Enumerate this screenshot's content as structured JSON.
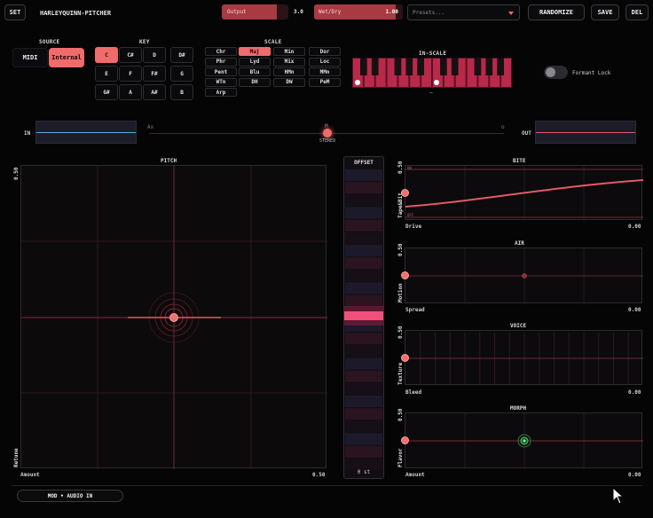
{
  "header": {
    "set_label": "SET",
    "plugin_name": "HARLEYQUINN-PITCHER",
    "output_label": "Output",
    "output_value": "3.0",
    "wet_label": "Wet/Dry",
    "wet_value": "1.00",
    "wet_fraction": 0.92,
    "output_fraction": 0.82,
    "presets_placeholder": "Presets...",
    "randomize_label": "RANDOMIZE",
    "save_label": "SAVE",
    "del_label": "DEL"
  },
  "source": {
    "title": "SOURCE",
    "options": [
      "MIDI",
      "Internal"
    ],
    "selected": "Internal"
  },
  "key": {
    "title": "KEY",
    "keys": [
      "C",
      "C#",
      "D",
      "D#",
      "E",
      "F",
      "F#",
      "G",
      "G#",
      "A",
      "A#",
      "B"
    ],
    "selected": "C"
  },
  "scale": {
    "title": "SCALE",
    "items": [
      "Chr",
      "Maj",
      "Min",
      "Dor",
      "Phr",
      "Lyd",
      "Mix",
      "Loc",
      "Pent",
      "Blu",
      "HMn",
      "MMn",
      "WTn",
      "DH",
      "DW",
      "PeM",
      "Arp"
    ],
    "selected": "Maj"
  },
  "inscale": {
    "title": "IN-SCALE",
    "dash": "–"
  },
  "formant": {
    "label": "Formant Lock"
  },
  "io": {
    "in_label": "IN",
    "out_label": "OUT",
    "left_mark": "Ax",
    "right_mark": "o",
    "center_mark": "M",
    "stereo_label": "STEREO"
  },
  "pitch": {
    "title": "PITCH",
    "y_value": "0.50",
    "y_label": "Retune",
    "x_label": "Amount",
    "x_value": "0.50"
  },
  "offset": {
    "title": "OFFSET",
    "value": "0 st",
    "fraction": 0.5
  },
  "bite": {
    "title": "BITE",
    "y_value": "0.50",
    "y_label": "Tape&Bit",
    "x_label": "Drive",
    "x_value": "0.00",
    "on_mark": "ON",
    "off_mark": "OFF"
  },
  "air": {
    "title": "AIR",
    "y_value": "0.50",
    "y_label": "Motion",
    "x_label": "Spread",
    "x_value": "0.00"
  },
  "voice": {
    "title": "VOICE",
    "y_value": "0.50",
    "y_label": "Texture",
    "x_label": "Bleed",
    "x_value": "0.00"
  },
  "morph": {
    "title": "MORPH",
    "y_value": "0.50",
    "y_label": "Flavor",
    "x_label": "Amount",
    "x_value": "0.00"
  },
  "footer": {
    "mod_label": "MOD • AUDIO IN"
  },
  "colors": {
    "accent": "#f06b6b",
    "deep_red": "#7a1a2a",
    "green": "#4bd06a"
  }
}
